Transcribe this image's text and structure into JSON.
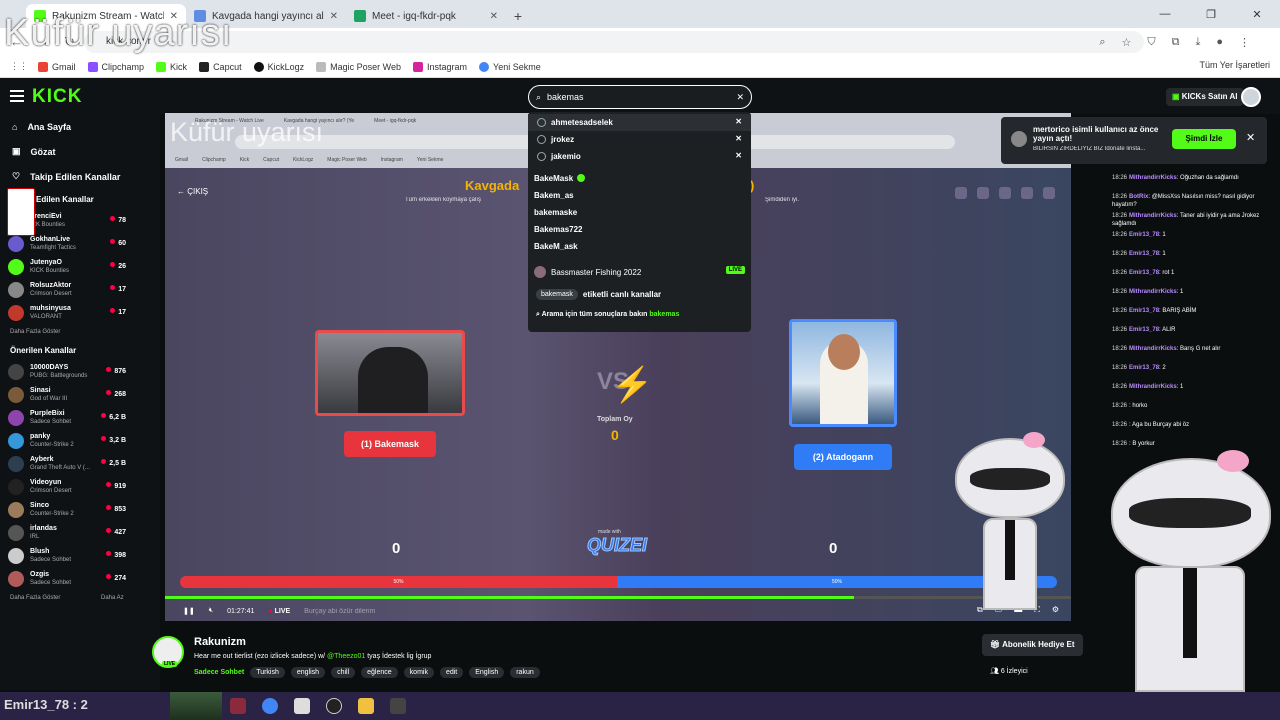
{
  "browser": {
    "tabs": [
      {
        "title": "Rakunizm Stream - Watch Live",
        "color": "#53fc18",
        "active": true
      },
      {
        "title": "Kavgada hangi yayıncı alır? (Ye",
        "color": "#5f8de0",
        "active": false
      },
      {
        "title": "Meet - igq-fkdr-pqk",
        "color": "#1ea362",
        "active": false
      }
    ],
    "url": "kick.com/r",
    "bookmarks": [
      "Gmail",
      "Clipchamp",
      "Kick",
      "Capcut",
      "KickLogz",
      "Magic Poser Web",
      "Instagram",
      "Yeni Sekme"
    ],
    "bookmarks_right": "Tüm Yer İşaretleri"
  },
  "overlay_caption": "Küfür uyarısı",
  "header": {
    "logo": "KICK",
    "search_value": "bakemas",
    "buy_kicks": "KICKs Satın Al"
  },
  "search_dropdown": {
    "recent": [
      "ahmetesadselek",
      "jrokez",
      "jakemio"
    ],
    "suggestions": [
      "BakeMask",
      "Bakem_as",
      "bakemaske",
      "Bakemas722",
      "BakeM_ask"
    ],
    "live_channel": {
      "name": "Bassmaster Fishing 2022",
      "badge": "LIVE"
    },
    "tag_row": {
      "tag": "bakemask",
      "text": "etiketli canlı kanallar"
    },
    "all_results": {
      "text": "Arama için tüm sonuçlara bakın",
      "query": "bakemas"
    }
  },
  "sidebar": {
    "nav": [
      "Ana Sayfa",
      "Gözat",
      "Takip Edilen Kanallar"
    ],
    "followed_title": "Edilen Kanallar",
    "followed": [
      {
        "name": "grenciEvi",
        "category": "ICK Bounties",
        "viewers": "78",
        "color": "#ffcc00"
      },
      {
        "name": "GokhanLive",
        "category": "Teamfight Tactics",
        "viewers": "60",
        "color": "#6a5acd"
      },
      {
        "name": "JutenyaO",
        "category": "KICK Bounties",
        "viewers": "26",
        "color": "#53fc18"
      },
      {
        "name": "RolsuzAktor",
        "category": "Crimson Desert",
        "viewers": "17",
        "color": "#888888"
      },
      {
        "name": "muhsinyusa",
        "category": "VALORANT",
        "viewers": "17",
        "color": "#c0392b"
      }
    ],
    "more": "Daha Fazla Göster",
    "recommended_title": "Önerilen Kanallar",
    "recommended": [
      {
        "name": "10000DAYS",
        "category": "PUBG: Battlegrounds",
        "viewers": "876",
        "color": "#444444"
      },
      {
        "name": "Sinasi",
        "category": "God of War III",
        "viewers": "268",
        "color": "#7a5a3a"
      },
      {
        "name": "PurpleBixi",
        "category": "Sadece Sohbet",
        "viewers": "6,2 B",
        "color": "#8e44ad"
      },
      {
        "name": "panky",
        "category": "Counter-Strike 2",
        "viewers": "3,2 B",
        "color": "#3498db"
      },
      {
        "name": "Ayberk",
        "category": "Grand Theft Auto V (...",
        "viewers": "2,5 B",
        "color": "#2c3e50"
      },
      {
        "name": "Videoyun",
        "category": "Crimson Desert",
        "viewers": "919",
        "color": "#222222"
      },
      {
        "name": "Sinco",
        "category": "Counter-Strike 2",
        "viewers": "853",
        "color": "#9b7b5b"
      },
      {
        "name": "irlandas",
        "category": "IRL",
        "viewers": "427",
        "color": "#555555"
      },
      {
        "name": "Blush",
        "category": "Sadece Sohbet",
        "viewers": "398",
        "color": "#cccccc"
      },
      {
        "name": "Ozgis",
        "category": "Sadece Sohbet",
        "viewers": "274",
        "color": "#b05a5a"
      }
    ],
    "more2": "Daha Fazla Göster",
    "less": "Daha Az"
  },
  "video": {
    "inner_caption": "Küfür uyarısı",
    "back": "ÇIKIŞ",
    "quiz_title": "Kavgada",
    "quiz_title_end": ")",
    "quiz_sub": "Tüm erkekleri koymaya çalış",
    "quiz_sub2": "Şimdiden iyi.",
    "player1": "(1) Bakemask",
    "player2": "(2) Atadogann",
    "vs": "VS",
    "total_label": "Toplam Oy",
    "total_value": "0",
    "score1": "0",
    "score2": "0",
    "made_with": "made with",
    "brand": "QUIZEI",
    "bar1_pct": 50,
    "bar2_pct": 50,
    "bar1_label": "50%",
    "bar2_label": "50%",
    "progress": 0.76,
    "time": "01:27:41",
    "live": "LIVE",
    "subtitle_ghost": "Burçay abi özür dilerim"
  },
  "notification": {
    "title": "mertorico isimli kullanıcı az önce yayın açtı!",
    "subtitle": "BİLİRSİN ZIRDELİYİZ BİZ İdonate linsta...",
    "watch": "Şimdi İzle"
  },
  "chat": [
    {
      "ts": "18:26",
      "user": "MithrandirrKicks",
      "text": "Oğuzhan da sağlamdı"
    },
    {
      "ts": "18:26",
      "user": "BotRix",
      "text": "@MissXss Nasılsın miss? nasıl gidiyor hayatım?"
    },
    {
      "ts": "18:26",
      "user": "MithrandirrKicks",
      "text": "Taner abi iyidir ya ama Jrokez sağlamdı"
    },
    {
      "ts": "18:26",
      "user": "Emir13_78",
      "text": "1"
    },
    {
      "ts": "18:26",
      "user": "Emir13_78",
      "text": "1"
    },
    {
      "ts": "18:26",
      "user": "Emir13_78",
      "text": "rot 1"
    },
    {
      "ts": "18:26",
      "user": "MithrandirrKicks",
      "text": "1"
    },
    {
      "ts": "18:26",
      "user": "Emir13_78",
      "text": "BARIŞ ABİM"
    },
    {
      "ts": "18:26",
      "user": "Emir13_78",
      "text": "ALIR"
    },
    {
      "ts": "18:26",
      "user": "MithrandirrKicks",
      "text": "Barış G net alır"
    },
    {
      "ts": "18:26",
      "user": "Emir13_78",
      "text": "2"
    },
    {
      "ts": "18:26",
      "user": "MithrandirrKicks",
      "text": "1"
    },
    {
      "ts": "18:26",
      "user": "",
      "text": "horko"
    },
    {
      "ts": "18:26",
      "user": "",
      "text": "Aga bu Burçay abi öz"
    },
    {
      "ts": "18:26",
      "user": "",
      "text": "B yorkur"
    }
  ],
  "stream": {
    "name": "Rakunizm",
    "live": "LIVE",
    "title_a": "Hear me out tierlist (ezo izlicek sadece) w/ ",
    "title_mention": "@Theezo01",
    "title_b": " tyaş İdestek lig İgrup",
    "category": "Sadece Sohbet",
    "tags": [
      "Turkish",
      "english",
      "chill",
      "eğlence",
      "komik",
      "edit",
      "English",
      "rakun"
    ],
    "gift": "Abonelik Hediye Et",
    "viewers": "6 İzleyici"
  },
  "taskbar": {
    "text": "Emir13_78 : 2"
  }
}
